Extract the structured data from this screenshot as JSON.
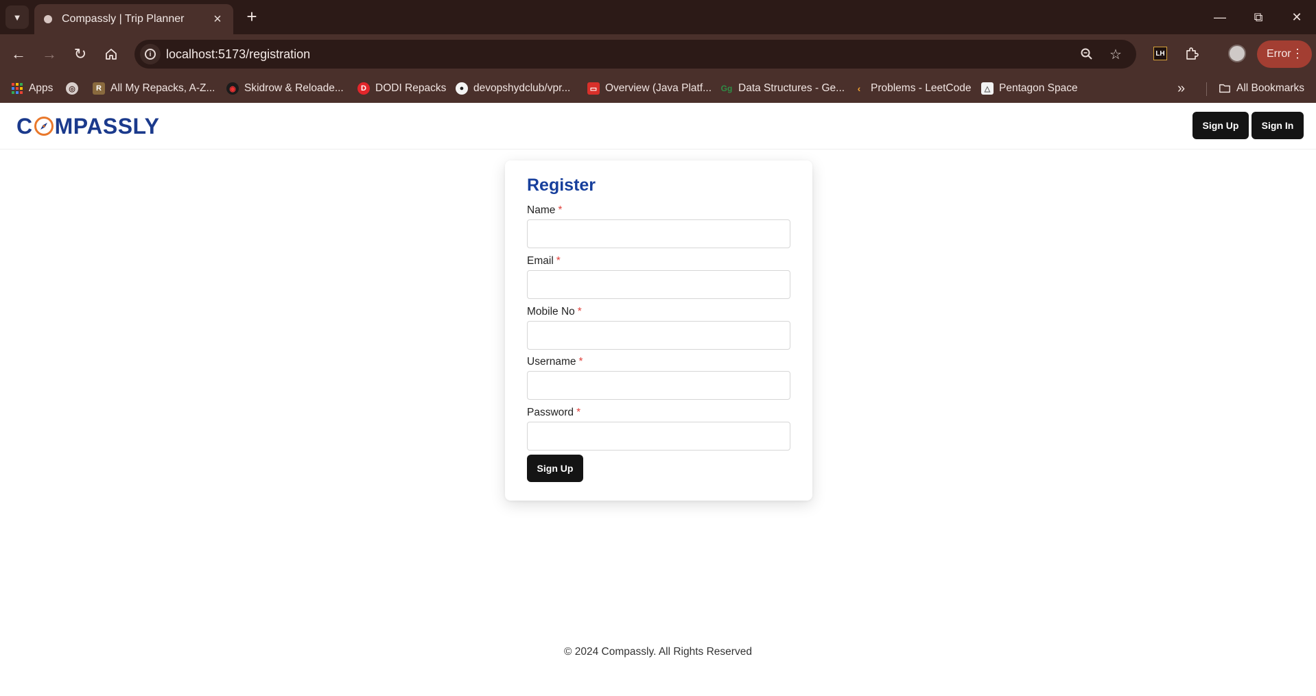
{
  "browser": {
    "tab_title": "Compassly | Trip Planner",
    "url": "localhost:5173/registration",
    "profile_status": "Error",
    "bookmarks": [
      {
        "label": "Apps",
        "icon": "apps-grid-icon"
      },
      {
        "label": "",
        "icon": "globe-icon"
      },
      {
        "label": "All My Repacks, A-Z...",
        "icon": "repacks-icon"
      },
      {
        "label": "Skidrow & Reloade...",
        "icon": "skidrow-icon"
      },
      {
        "label": "DODI Repacks",
        "icon": "dodi-icon"
      },
      {
        "label": "devopshydclub/vpr...",
        "icon": "github-icon"
      },
      {
        "label": "Overview (Java Platf...",
        "icon": "oracle-icon"
      },
      {
        "label": "Data Structures - Ge...",
        "icon": "geeksforgeeks-icon"
      },
      {
        "label": "Problems - LeetCode",
        "icon": "leetcode-icon"
      },
      {
        "label": "Pentagon Space",
        "icon": "pentagon-icon"
      }
    ],
    "all_bookmarks_label": "All Bookmarks",
    "colors": {
      "frame": "#2c1a17",
      "toolbar": "#4a302b",
      "error_pill": "#a33e32"
    }
  },
  "site": {
    "logo_text_left": "C",
    "logo_text_right": "MPASSLY",
    "header_buttons": {
      "signup": "Sign Up",
      "signin": "Sign In"
    },
    "colors": {
      "brand_blue": "#1b3a8c",
      "accent_orange": "#e9782b",
      "button_dark": "#141414",
      "required_red": "#e0423d"
    }
  },
  "form": {
    "title": "Register",
    "fields": [
      {
        "label": "Name",
        "required": "*",
        "value": "",
        "placeholder": ""
      },
      {
        "label": "Email",
        "required": "*",
        "value": "",
        "placeholder": ""
      },
      {
        "label": "Mobile No",
        "required": "*",
        "value": "",
        "placeholder": ""
      },
      {
        "label": "Username",
        "required": "*",
        "value": "",
        "placeholder": ""
      },
      {
        "label": "Password",
        "required": "*",
        "value": "",
        "placeholder": ""
      }
    ],
    "submit_label": "Sign Up"
  },
  "footer": {
    "text": "© 2024 Compassly. All Rights Reserved"
  }
}
